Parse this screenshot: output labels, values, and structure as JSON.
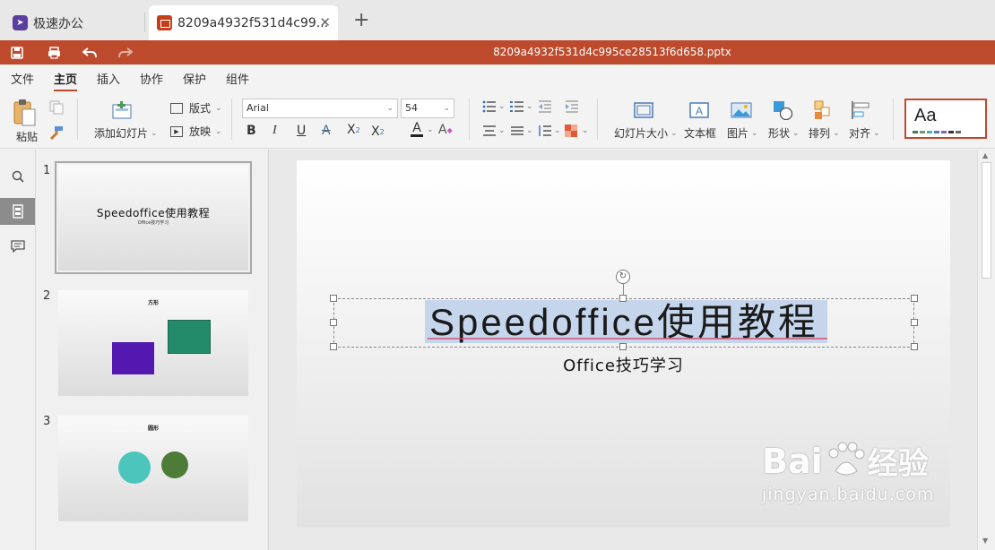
{
  "tabs": [
    {
      "label": "极速办公",
      "icon": "rocket-icon"
    },
    {
      "label": "8209a4932f531d4c99...",
      "icon": "presentation-icon"
    }
  ],
  "new_tab": "+",
  "close_tab": "✕",
  "file_title": "8209a4932f531d4c995ce28513f6d658.pptx",
  "menu": [
    "文件",
    "主页",
    "插入",
    "协作",
    "保护",
    "组件"
  ],
  "toolbar": {
    "paste": "粘贴",
    "add_slide": "添加幻灯片",
    "layout": "版式",
    "play": "放映",
    "font_name": "Arial",
    "font_size": "54",
    "bold": "B",
    "italic": "I",
    "underline": "U",
    "strike": "A",
    "superscript": "X",
    "subscript": "X",
    "sup_mark": "2",
    "sub_mark": "2",
    "font_color": "A",
    "highlight": "A",
    "slide_size": "幻灯片大小",
    "textbox": "文本框",
    "picture": "图片",
    "shape": "形状",
    "arrange": "排列",
    "align": "对齐",
    "theme_label": "Aa"
  },
  "thumbnails": [
    {
      "num": "1",
      "title": "Speedoffice使用教程",
      "subtitle": "Office技巧学习"
    },
    {
      "num": "2",
      "title": "方形"
    },
    {
      "num": "3",
      "title": "圆形"
    }
  ],
  "slide": {
    "title": "Speedoffice使用教程",
    "subtitle": "Office技巧学习"
  },
  "watermark": {
    "brand": "Bai",
    "brand2": "经验",
    "url": "jingyan.baidu.com"
  },
  "colors": {
    "accent": "#bd4a2c",
    "purple_square": "#5318b0",
    "green_square": "#238a6a",
    "teal_circle": "#4cc6bd",
    "green_circle": "#4d7c38"
  }
}
